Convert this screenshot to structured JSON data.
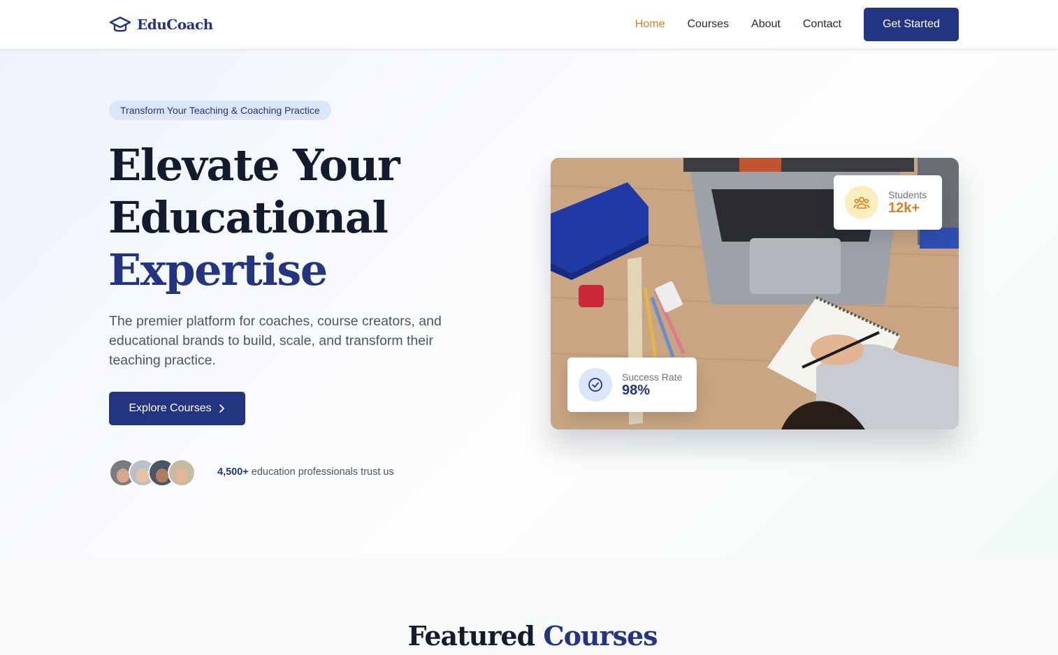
{
  "nav": {
    "brand": "EduCoach",
    "links": [
      "Home",
      "Courses",
      "About",
      "Contact"
    ],
    "active": "Home",
    "cta": "Get Started"
  },
  "hero": {
    "badge": "Transform Your Teaching & Coaching Practice",
    "title_line1": "Elevate Your",
    "title_line2": "Educational",
    "title_accent": "Expertise",
    "lead": "The premier platform for coaches, course creators, and educational brands to build, scale, and transform their teaching practice.",
    "explore_button": "Explore Courses",
    "trust_count": "4,500+",
    "trust_text": " education professionals trust us"
  },
  "stats": {
    "students_label": "Students",
    "students_value": "12k+",
    "success_label": "Success Rate",
    "success_value": "98%"
  },
  "featured": {
    "title": "Featured",
    "title_accent": "Courses"
  },
  "colors": {
    "primary": "#233580",
    "accent": "#d97f1e",
    "badge_bg": "#dbe6fb"
  }
}
